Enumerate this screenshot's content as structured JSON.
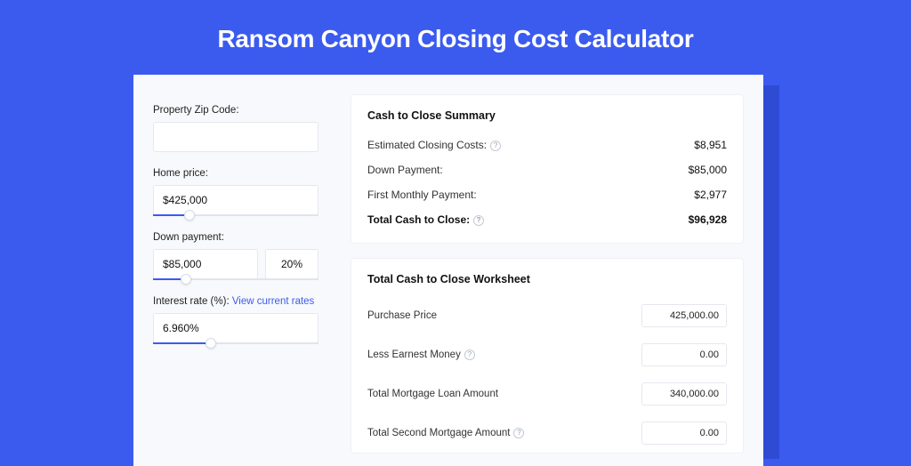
{
  "title": "Ransom Canyon Closing Cost Calculator",
  "left": {
    "zip_label": "Property Zip Code:",
    "zip_value": "",
    "price_label": "Home price:",
    "price_value": "$425,000",
    "price_slider_pct": 22,
    "dp_label": "Down payment:",
    "dp_value": "$85,000",
    "dp_pct": "20%",
    "dp_slider_pct": 20,
    "rate_label": "Interest rate (%):",
    "rate_link": "View current rates",
    "rate_value": "6.960%",
    "rate_slider_pct": 35
  },
  "summary": {
    "heading": "Cash to Close Summary",
    "rows": [
      {
        "label": "Estimated Closing Costs:",
        "help": true,
        "value": "$8,951",
        "bold": false
      },
      {
        "label": "Down Payment:",
        "help": false,
        "value": "$85,000",
        "bold": false
      },
      {
        "label": "First Monthly Payment:",
        "help": false,
        "value": "$2,977",
        "bold": false
      },
      {
        "label": "Total Cash to Close:",
        "help": true,
        "value": "$96,928",
        "bold": true
      }
    ]
  },
  "worksheet": {
    "heading": "Total Cash to Close Worksheet",
    "rows": [
      {
        "label": "Purchase Price",
        "help": false,
        "value": "425,000.00"
      },
      {
        "label": "Less Earnest Money",
        "help": true,
        "value": "0.00"
      },
      {
        "label": "Total Mortgage Loan Amount",
        "help": false,
        "value": "340,000.00"
      },
      {
        "label": "Total Second Mortgage Amount",
        "help": true,
        "value": "0.00"
      }
    ]
  }
}
